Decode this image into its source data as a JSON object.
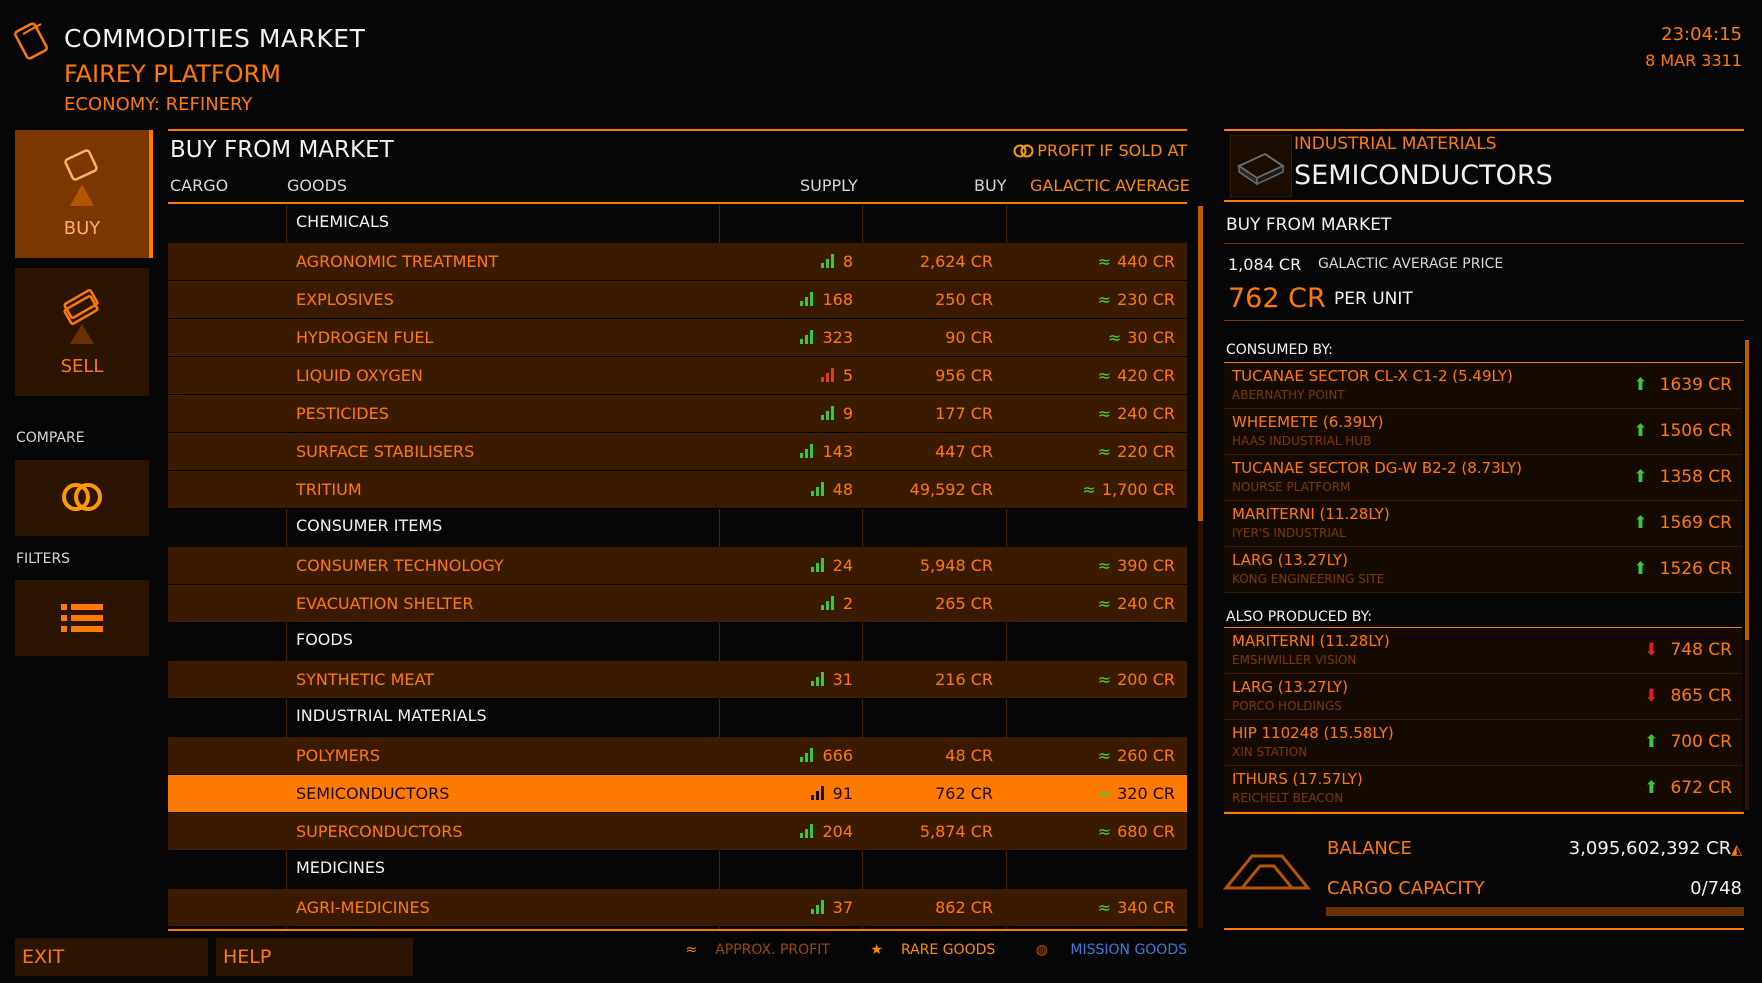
{
  "header": {
    "title": "COMMODITIES MARKET",
    "station": "FAIREY PLATFORM",
    "economy": "ECONOMY: REFINERY",
    "time": "23:04:15",
    "date": "8 MAR 3311"
  },
  "nav": {
    "buy": "BUY",
    "sell": "SELL",
    "compare_label": "COMPARE",
    "filters_label": "FILTERS"
  },
  "market": {
    "title": "BUY FROM MARKET",
    "profit_label": "PROFIT IF SOLD AT",
    "columns": {
      "cargo": "CARGO",
      "goods": "GOODS",
      "supply": "SUPPLY",
      "buy": "BUY",
      "galactic": "GALACTIC AVERAGE"
    },
    "rows": [
      {
        "type": "category",
        "name": "CHEMICALS"
      },
      {
        "type": "item",
        "name": "AGRONOMIC TREATMENT",
        "supply": "8",
        "supply_level": "good",
        "buy": "2,624 CR",
        "galactic": "440 CR"
      },
      {
        "type": "item",
        "name": "EXPLOSIVES",
        "supply": "168",
        "supply_level": "good",
        "buy": "250 CR",
        "galactic": "230 CR"
      },
      {
        "type": "item",
        "name": "HYDROGEN FUEL",
        "supply": "323",
        "supply_level": "good",
        "buy": "90 CR",
        "galactic": "30 CR"
      },
      {
        "type": "item",
        "name": "LIQUID OXYGEN",
        "supply": "5",
        "supply_level": "low",
        "buy": "956 CR",
        "galactic": "420 CR"
      },
      {
        "type": "item",
        "name": "PESTICIDES",
        "supply": "9",
        "supply_level": "good",
        "buy": "177 CR",
        "galactic": "240 CR"
      },
      {
        "type": "item",
        "name": "SURFACE STABILISERS",
        "supply": "143",
        "supply_level": "good",
        "buy": "447 CR",
        "galactic": "220 CR"
      },
      {
        "type": "item",
        "name": "TRITIUM",
        "supply": "48",
        "supply_level": "good",
        "buy": "49,592 CR",
        "galactic": "1,700 CR"
      },
      {
        "type": "category",
        "name": "CONSUMER ITEMS"
      },
      {
        "type": "item",
        "name": "CONSUMER TECHNOLOGY",
        "supply": "24",
        "supply_level": "good",
        "buy": "5,948 CR",
        "galactic": "390 CR"
      },
      {
        "type": "item",
        "name": "EVACUATION SHELTER",
        "supply": "2",
        "supply_level": "good",
        "buy": "265 CR",
        "galactic": "240 CR"
      },
      {
        "type": "category",
        "name": "FOODS"
      },
      {
        "type": "item",
        "name": "SYNTHETIC MEAT",
        "supply": "31",
        "supply_level": "good",
        "buy": "216 CR",
        "galactic": "200 CR"
      },
      {
        "type": "category",
        "name": "INDUSTRIAL MATERIALS"
      },
      {
        "type": "item",
        "name": "POLYMERS",
        "supply": "666",
        "supply_level": "good",
        "buy": "48 CR",
        "galactic": "260 CR"
      },
      {
        "type": "item",
        "name": "SEMICONDUCTORS",
        "supply": "91",
        "supply_level": "good",
        "buy": "762 CR",
        "galactic": "320 CR",
        "selected": true
      },
      {
        "type": "item",
        "name": "SUPERCONDUCTORS",
        "supply": "204",
        "supply_level": "good",
        "buy": "5,874 CR",
        "galactic": "680 CR"
      },
      {
        "type": "category",
        "name": "MEDICINES"
      },
      {
        "type": "item",
        "name": "AGRI-MEDICINES",
        "supply": "37",
        "supply_level": "good",
        "buy": "862 CR",
        "galactic": "340 CR"
      }
    ],
    "approx_symbol": "≈"
  },
  "legend": {
    "approx": "APPROX. PROFIT",
    "rare": "RARE GOODS",
    "mission": "MISSION GOODS"
  },
  "buttons": {
    "exit": "EXIT",
    "help": "HELP"
  },
  "details": {
    "category": "INDUSTRIAL MATERIALS",
    "name": "SEMICONDUCTORS",
    "buy_header": "BUY FROM MARKET",
    "galactic_price": "1,084 CR",
    "galactic_price_label": "GALACTIC AVERAGE PRICE",
    "unit_price": "762 CR",
    "unit_label": "PER UNIT",
    "consumed_header": "CONSUMED BY:",
    "consumed": [
      {
        "name": "TUCANAE SECTOR CL-X C1-2 (5.49LY)",
        "sub": "ABERNATHY POINT",
        "price": "1639 CR",
        "trend": "up"
      },
      {
        "name": "WHEEMETE (6.39LY)",
        "sub": "HAAS INDUSTRIAL HUB",
        "price": "1506 CR",
        "trend": "up"
      },
      {
        "name": "TUCANAE SECTOR DG-W B2-2 (8.73LY)",
        "sub": "NOURSE PLATFORM",
        "price": "1358 CR",
        "trend": "up"
      },
      {
        "name": "MARITERNI (11.28LY)",
        "sub": "IYER'S INDUSTRIAL",
        "price": "1569 CR",
        "trend": "up"
      },
      {
        "name": "LARG (13.27LY)",
        "sub": "KONG ENGINEERING SITE",
        "price": "1526 CR",
        "trend": "up"
      }
    ],
    "produced_header": "ALSO PRODUCED BY:",
    "produced": [
      {
        "name": "MARITERNI (11.28LY)",
        "sub": "EMSHWILLER VISION",
        "price": "748 CR",
        "trend": "down"
      },
      {
        "name": "LARG (13.27LY)",
        "sub": "PORCO HOLDINGS",
        "price": "865 CR",
        "trend": "down"
      },
      {
        "name": "HIP 110248 (15.58LY)",
        "sub": "XIN STATION",
        "price": "700 CR",
        "trend": "up"
      },
      {
        "name": "ITHURS (17.57LY)",
        "sub": "REICHELT BEACON",
        "price": "672 CR",
        "trend": "up"
      }
    ]
  },
  "status": {
    "balance_label": "BALANCE",
    "balance": "3,095,602,392 CR",
    "cargo_label": "CARGO CAPACITY",
    "cargo": "0/748",
    "cargo_fill": 0
  }
}
